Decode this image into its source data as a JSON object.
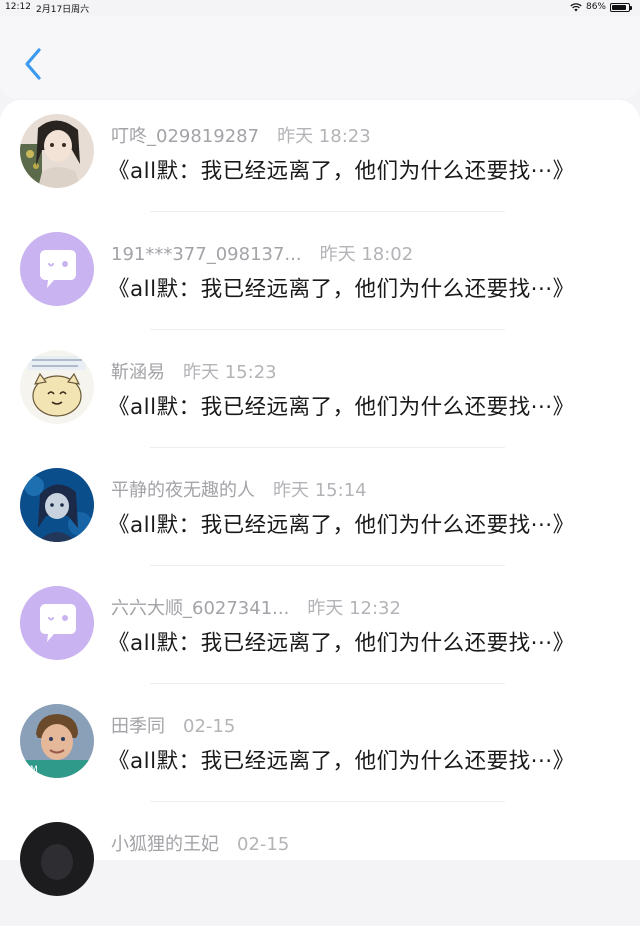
{
  "status_bar": {
    "time": "12:12",
    "date": "2月17日周六",
    "battery": "86%"
  },
  "header": {
    "back_icon": "chevron-left-icon",
    "accent_color": "#3a9af2"
  },
  "items": [
    {
      "name": "叮咚_029819287",
      "time": "昨天 18:23",
      "message": "《all默：我已经远离了，他们为什么还要找···》",
      "avatar": "anime-girl"
    },
    {
      "name": "191***377_098137...",
      "time": "昨天 18:02",
      "message": "《all默：我已经远离了，他们为什么还要找···》",
      "avatar": "default-chat"
    },
    {
      "name": "靳涵易",
      "time": "昨天 15:23",
      "message": "《all默：我已经远离了，他们为什么还要找···》",
      "avatar": "cartoon-cat"
    },
    {
      "name": "平静的夜无趣的人",
      "time": "昨天 15:14",
      "message": "《all默：我已经远离了，他们为什么还要找···》",
      "avatar": "blue-anime"
    },
    {
      "name": "六六大顺_6027341...",
      "time": "昨天 12:32",
      "message": "《all默：我已经远离了，他们为什么还要找···》",
      "avatar": "default-chat"
    },
    {
      "name": "田季同",
      "time": "02-15",
      "message": "《all默：我已经远离了，他们为什么还要找···》",
      "avatar": "photo-man"
    },
    {
      "name": "小狐狸的王妃",
      "time": "02-15",
      "message": "",
      "avatar": "dark"
    }
  ]
}
